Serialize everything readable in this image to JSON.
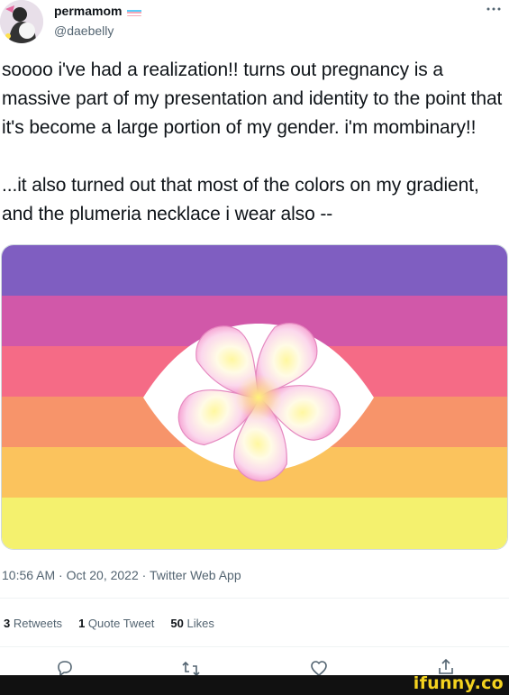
{
  "user": {
    "display_name": "permamom",
    "handle": "@daebelly",
    "avatar_icon": "avatar-icon",
    "flag_icon": "trans-flag-icon"
  },
  "tweet": {
    "paragraphs": [
      "soooo i've had a realization!! turns out pregnancy is a massive part of my presentation and identity to the point that it's become a large portion of my gender. i'm mombinary!!",
      "...it also turned out that most of the colors on my gradient, and the plumeria necklace i wear also --"
    ]
  },
  "image": {
    "stripe_colors": [
      "#7f5ec1",
      "#d158a9",
      "#f56b86",
      "#f7946a",
      "#fbc35d",
      "#f4f16e"
    ]
  },
  "meta": {
    "timestamp": "10:56 AM · Oct 20, 2022 · Twitter Web App"
  },
  "stats": {
    "retweets_count": "3",
    "retweets_label": "Retweets",
    "quotes_count": "1",
    "quotes_label": "Quote Tweet",
    "likes_count": "50",
    "likes_label": "Likes"
  },
  "actions": {
    "reply_icon": "reply-icon",
    "retweet_icon": "retweet-icon",
    "like_icon": "heart-icon",
    "share_icon": "share-icon"
  },
  "watermark": "ifunny.co"
}
